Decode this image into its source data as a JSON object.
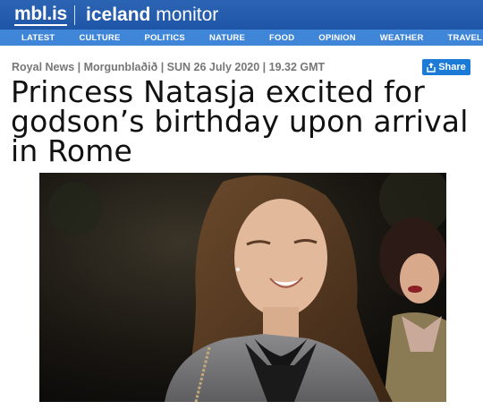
{
  "brand": {
    "site": "mbl.is",
    "section_bold": "iceland",
    "section_light": "monitor"
  },
  "nav": {
    "items": [
      "LATEST",
      "CULTURE",
      "POLITICS",
      "NATURE",
      "FOOD",
      "OPINION",
      "WEATHER",
      "TRAVEL"
    ]
  },
  "article": {
    "meta": "Royal News | Morgunblaðið | SUN 26 July 2020 | 19.32 GMT",
    "share_label": "Share",
    "headline": "Princess Natasja excited for godson’s birthday upon arrival in Rome"
  },
  "colors": {
    "brand_bar": "#2361b0",
    "nav_bar": "#3f86d8",
    "share_button": "#1d7bd8"
  }
}
